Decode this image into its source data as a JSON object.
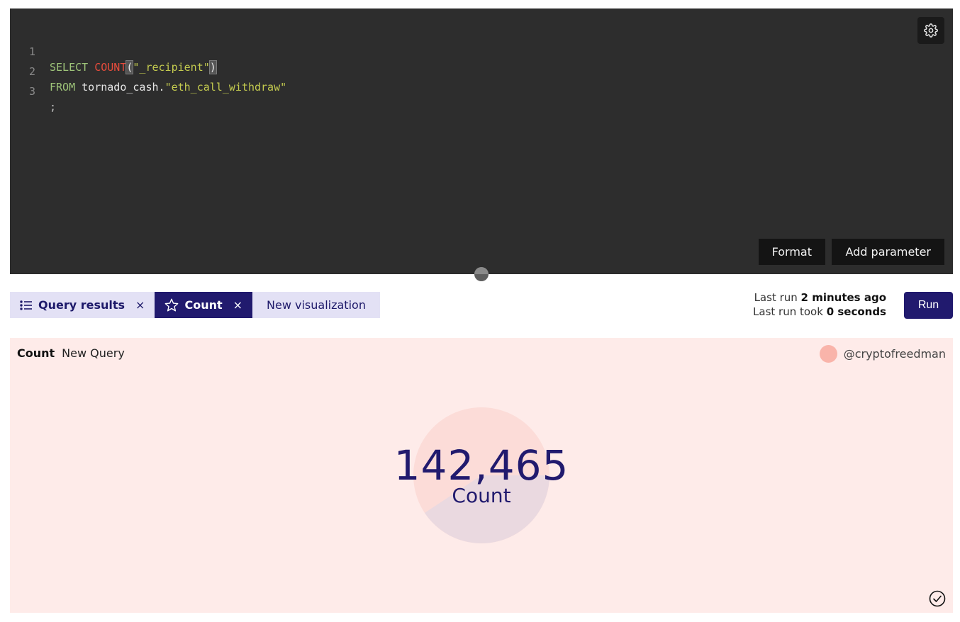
{
  "editor": {
    "lines": [
      {
        "num": "1",
        "kw": "SELECT",
        "fn": "COUNT",
        "open": "(",
        "str": "\"_recipient\"",
        "close": ")"
      },
      {
        "num": "2",
        "kw": "FROM",
        "id": "tornado_cash.",
        "str": "\"eth_call_withdraw\""
      },
      {
        "num": "3",
        "punc": ";"
      }
    ],
    "format_label": "Format",
    "add_parameter_label": "Add parameter",
    "settings_icon": "gear-icon"
  },
  "tabs": [
    {
      "label": "Query results",
      "icon": "list-icon",
      "close": "×"
    },
    {
      "label": "Count",
      "icon": "star-icon",
      "close": "×"
    },
    {
      "label": "New visualization"
    }
  ],
  "last_run": {
    "prefix": "Last run",
    "value": "2 minutes ago",
    "took_prefix": "Last run took",
    "took_value": "0 seconds"
  },
  "run_label": "Run",
  "visualization": {
    "name": "Count",
    "query_name": "New Query",
    "author": "@cryptofreedman",
    "counter_value": "142,465",
    "counter_label": "Count"
  },
  "colors": {
    "brand": "#211a6e",
    "editor_bg": "#2d2d2d",
    "viz_bg": "#feebe9",
    "avatar": "#f9b4aa"
  }
}
